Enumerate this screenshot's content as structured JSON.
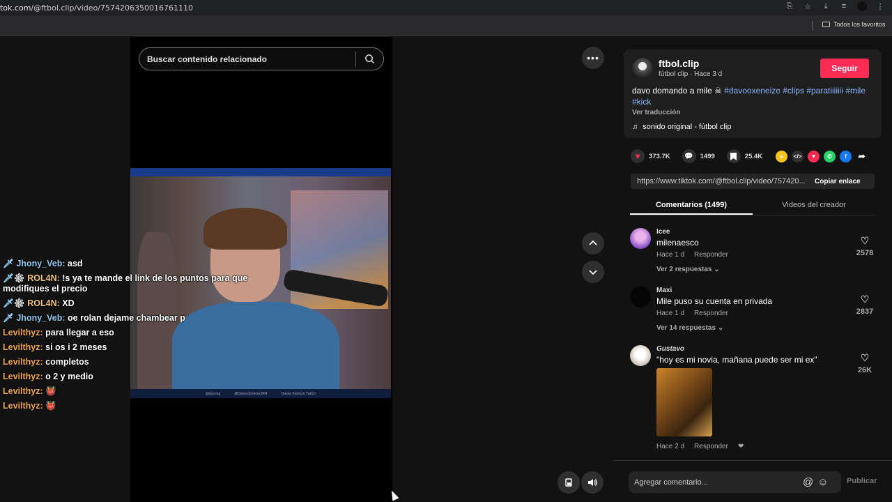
{
  "browser": {
    "url_prefix": "tok.com",
    "url_path": "/@ftbol.clip/video/7574206350016761110",
    "bookmarks_label": "Todos los favoritos"
  },
  "search": {
    "placeholder": "Buscar contenido relacionado"
  },
  "video": {
    "footer_items": [
      "@davoxg",
      "@DavooXeneizeJRR",
      "Davoo Xeneize Twitch"
    ]
  },
  "chat": [
    {
      "user": "Jhony_Veb:",
      "msg": "asd",
      "badge": "sword",
      "color": "blue"
    },
    {
      "user": "ROL4N:",
      "msg": "!s ya te mande el link de los puntos para que modifiques el precio",
      "badge": "sword-mod",
      "color": "gold"
    },
    {
      "user": "ROL4N:",
      "msg": "XD",
      "badge": "sword-mod",
      "color": "gold"
    },
    {
      "user": "Jhony_Veb:",
      "msg": "oe rolan dejame chambear p",
      "badge": "sword",
      "color": "blue"
    },
    {
      "user": "Levilthyz:",
      "msg": "para llegar a eso",
      "color": "orange"
    },
    {
      "user": "Levilthyz:",
      "msg": "si os i 2 meses",
      "color": "orange"
    },
    {
      "user": "Levilthyz:",
      "msg": "completos",
      "color": "orange"
    },
    {
      "user": "Levilthyz:",
      "msg": "o 2 y medio",
      "color": "orange"
    },
    {
      "user": "Levilthyz:",
      "msg": "",
      "emote": true,
      "color": "orange"
    },
    {
      "user": "Levilthyz:",
      "msg": "",
      "emote": true,
      "color": "orange"
    }
  ],
  "creator": {
    "name": "ftbol.clip",
    "subtitle": "fútbol clip · Hace 3 d",
    "follow_label": "Seguir"
  },
  "post": {
    "caption_text": "davo domando a mile",
    "hashtags": [
      "#davooxeneize",
      "#clips",
      "#paratiiiiiii",
      "#mile",
      "#kick"
    ],
    "translate_label": "Ver traducción",
    "sound": "sonido original - fútbol clip"
  },
  "stats": {
    "likes": "373.7K",
    "comments": "1499",
    "saves": "25.4K"
  },
  "link": {
    "url": "https://www.tiktok.com/@ftbol.clip/video/757420...",
    "copy_label": "Copiar enlace"
  },
  "tabs": [
    {
      "label": "Comentarios (1499)",
      "active": true
    },
    {
      "label": "Videos del creador",
      "active": false
    }
  ],
  "comments": [
    {
      "user": "Icee",
      "text": "milenaesco",
      "time": "Hace 1 d",
      "reply": "Responder",
      "replies": "Ver 2 respuestas",
      "likes": "2578",
      "avatar_color": "#b45ad6"
    },
    {
      "user": "Maxi",
      "text": "Mile puso su cuenta en privada",
      "time": "Hace 1 d",
      "reply": "Responder",
      "replies": "Ver 14 respuestas",
      "likes": "2837",
      "avatar_color": "#000000"
    },
    {
      "user": "Gustavo",
      "text": "\"hoy es mi novia, mañana puede ser mi ex\"",
      "time": "Hace 2 d",
      "reply": "Responder",
      "replies": "",
      "likes": "26K",
      "avatar_color": "#d9d0c8"
    }
  ],
  "compose": {
    "placeholder": "Agregar comentario...",
    "publish_label": "Publicar"
  },
  "colors": {
    "accent": "#fe2c55",
    "link": "#8ab4f8",
    "background": "#121212"
  }
}
